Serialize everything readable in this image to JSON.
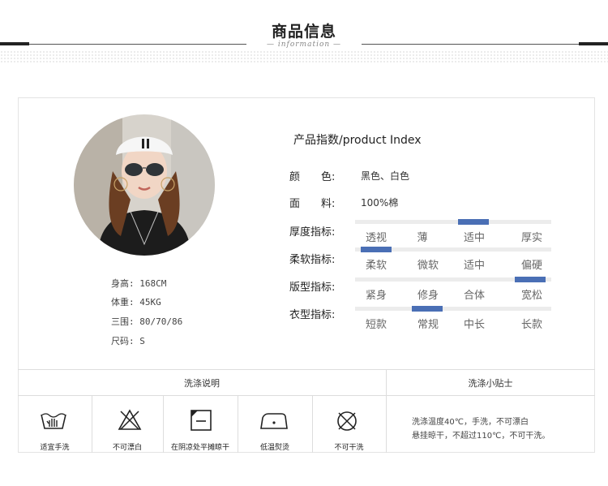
{
  "header": {
    "title": "商品信息",
    "subtitle": "— information —"
  },
  "model": {
    "stats": [
      "身高: 168CM",
      "体重: 45KG",
      "三围: 80/70/86",
      "尺码: S"
    ]
  },
  "product": {
    "title": "产品指数/product Index",
    "color_label": "颜　　色:",
    "color_value": "黑色、白色",
    "material_label": "面　　料:",
    "material_value": "100%棉",
    "indicators": [
      {
        "label": "厚度指标:",
        "options": [
          "透视",
          "薄",
          "适中",
          "厚实"
        ],
        "selected": 2
      },
      {
        "label": "柔软指标:",
        "options": [
          "柔软",
          "微软",
          "适中",
          "偏硬"
        ],
        "selected": 0
      },
      {
        "label": "版型指标:",
        "options": [
          "紧身",
          "修身",
          "合体",
          "宽松"
        ],
        "selected": 3
      },
      {
        "label": "衣型指标:",
        "options": [
          "短款",
          "常规",
          "中长",
          "长款"
        ],
        "selected": 1
      }
    ],
    "accent_color": "#4a6fb5"
  },
  "wash": {
    "title": "洗涤说明",
    "tips_title": "洗涤小贴士",
    "tips": [
      "洗涤温度40℃，手洗，不可漂白",
      "悬挂晾干，不超过110℃，不可干洗。"
    ],
    "items": [
      {
        "icon": "hand-wash-icon",
        "label": "适宜手洗"
      },
      {
        "icon": "no-bleach-icon",
        "label": "不可漂白"
      },
      {
        "icon": "shade-dry-icon",
        "label": "在阴凉处平摊晾干"
      },
      {
        "icon": "low-iron-icon",
        "label": "低温熨烫"
      },
      {
        "icon": "no-dry-clean-icon",
        "label": "不可干洗"
      }
    ]
  }
}
